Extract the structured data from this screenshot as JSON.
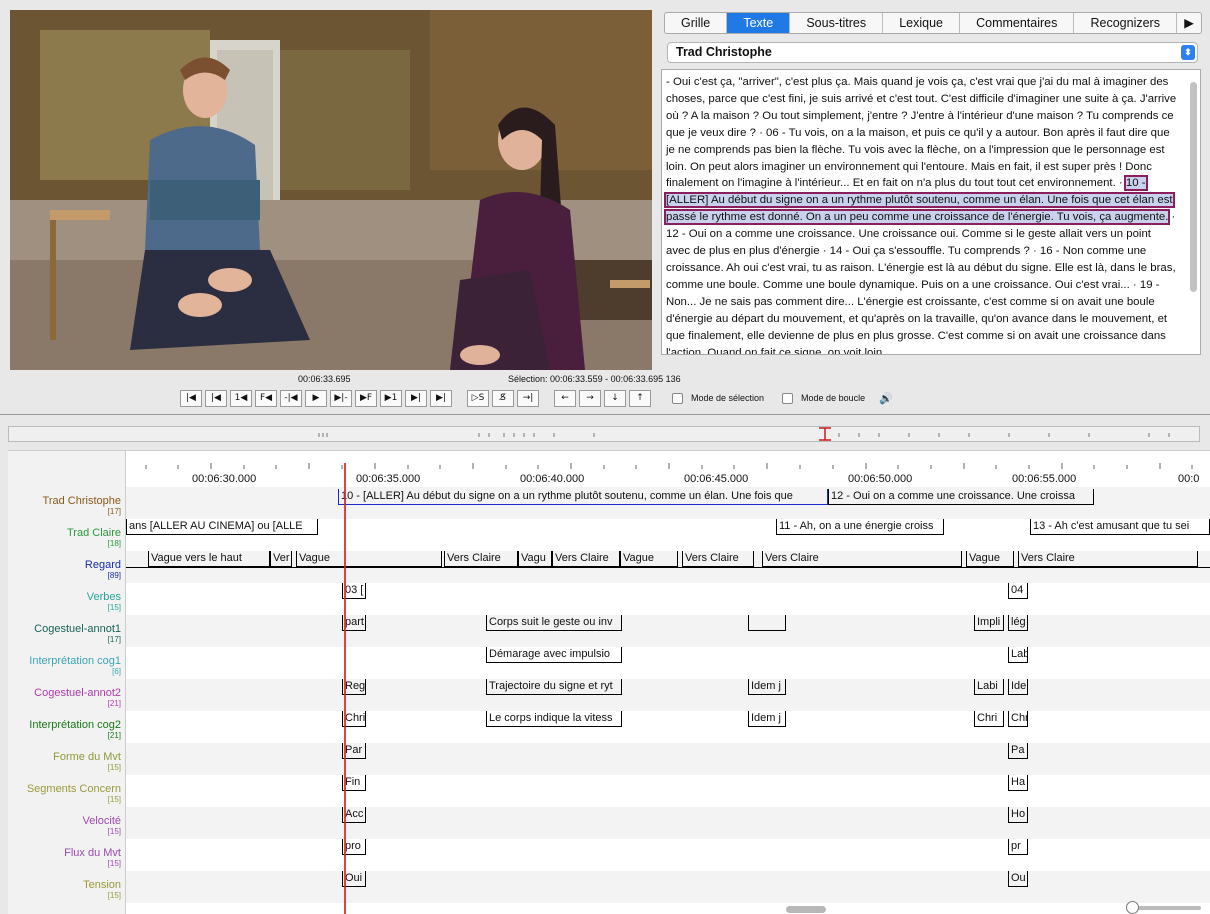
{
  "tabs": [
    "Grille",
    "Texte",
    "Sous-titres",
    "Lexique",
    "Commentaires",
    "Recognizers"
  ],
  "active_tab": "Texte",
  "more_tabs_glyph": "▶",
  "selected_tier": "Trad Christophe",
  "text": {
    "before": "- Oui c'est ça, \"arriver\", c'est plus ça. Mais quand je vois ça, c'est vrai que j'ai du mal à imaginer des choses, parce que c'est fini, je suis arrivé et c'est tout. C'est difficile d'imaginer une suite à ça. J'arrive où ? A la maison ? Ou tout simplement, j'entre ? J'entre à l'intérieur d'une maison ? Tu comprends ce que je veux dire ? · 06 - Tu vois, on a la maison, et puis ce qu'il y a autour. Bon après il faut dire que je ne comprends pas bien la flèche. Tu vois avec la flèche, on a l'impression que le personnage est loin. On peut alors imaginer un environnement qui l'entoure. Mais en fait, il est super près ! Donc finalement on l'imagine à l'intérieur... Et en fait on n'a plus du tout tout cet environnement. · ",
    "highlight": "10 - [ALLER] Au début du signe on a un rythme plutôt soutenu, comme un élan. Une fois que cet élan est passé le rythme est donné. On a un peu comme une croissance de l'énergie. Tu vois, ça augmente.",
    "after": " · 12 - Oui on a comme une croissance. Une croissance oui. Comme si le geste allait vers un point avec de plus en plus d'énergie · 14 - Oui ça s'essouffle. Tu comprends ? · 16 - Non comme une croissance. Ah oui c'est vrai, tu as raison. L'énergie est là au début du signe. Elle est là, dans le bras, comme une boule. Comme une boule dynamique. Puis on a une croissance. Oui c'est vrai... · 19 - Non... Je ne sais pas comment dire... L'énergie est croissante, c'est comme si on avait une boule d'énergie au départ du mouvement, et qu'après on la travaille, qu'on avance dans le mouvement, et que finalement, elle devienne de plus en plus grosse. C'est comme si on avait une croissance dans l'action. Quand on fait ce signe, on voit loin,"
  },
  "media": {
    "current_time": "00:06:33.695",
    "selection": "Sélection: 00:06:33.559 - 00:06:33.695  136",
    "buttons": [
      "|◀",
      "|◀",
      "1◀",
      "F◀",
      "-|◀",
      "▶",
      "▶|-",
      "▶F",
      "▶1",
      "▶|",
      "▶|"
    ],
    "sel_buttons": [
      "▷S",
      "S̸",
      "→|"
    ],
    "nav_buttons": [
      "←",
      "→",
      "↓",
      "↑"
    ],
    "selection_mode": "Mode de sélection",
    "loop_mode": "Mode de boucle"
  },
  "ruler": [
    "00:06:30.000",
    "00:06:35.000",
    "00:06:40.000",
    "00:06:45.000",
    "00:06:50.000",
    "00:06:55.000",
    "00:0"
  ],
  "tiers": [
    {
      "name": "Trad Christophe",
      "count": "[17]",
      "color": "#8a5a1a"
    },
    {
      "name": "Trad Claire",
      "count": "[18]",
      "color": "#2a9a3a"
    },
    {
      "name": "Regard",
      "count": "[89]",
      "color": "#1a2cb0"
    },
    {
      "name": "Verbes",
      "count": "[15]",
      "color": "#2aa59a"
    },
    {
      "name": "Cogestuel-annot1",
      "count": "[17]",
      "color": "#17645a"
    },
    {
      "name": "Interprétation cog1",
      "count": "[6]",
      "color": "#3aa5b5"
    },
    {
      "name": "Cogestuel-annot2",
      "count": "[21]",
      "color": "#b03ab0"
    },
    {
      "name": "Interprétation cog2",
      "count": "[21]",
      "color": "#1a7a1a"
    },
    {
      "name": "Forme du Mvt",
      "count": "[15]",
      "color": "#8f9a3a"
    },
    {
      "name": "Segments Concern",
      "count": "[15]",
      "color": "#9a9a3a"
    },
    {
      "name": "Velocité",
      "count": "[15]",
      "color": "#a04ab0"
    },
    {
      "name": "Flux du Mvt",
      "count": "[15]",
      "color": "#9a4ab0"
    },
    {
      "name": "Tension",
      "count": "[15]",
      "color": "#9a9a3a"
    }
  ],
  "annotations": {
    "trad_christophe": [
      "10 - [ALLER] Au début du signe on a un rythme plutôt soutenu, comme un élan. Une fois que",
      "12 - Oui on a comme une croissance. Une croissa"
    ],
    "trad_claire": [
      "ans [ALLER AU CINEMA] ou [ALLE",
      "11 - Ah, on a une énergie croiss",
      "13 - Ah c'est amusant que tu sei"
    ],
    "regard": [
      "Vague vers le haut",
      "Ver",
      "Vague",
      "Vers Claire",
      "Vagu",
      "Vers Claire",
      "Vague",
      "Vers Claire",
      "Vers Claire",
      "Vague",
      "Vers Claire"
    ],
    "verbes": [
      "03 [",
      "04"
    ],
    "cog1": [
      "part",
      "Corps suit le geste ou inv",
      "Impli",
      "lég"
    ],
    "interp1": [
      "Démarage avec impulsio",
      "Lab"
    ],
    "cog2": [
      "Reg",
      "Trajectoire du signe et ryt",
      "Idem j",
      "Labi",
      "Ide"
    ],
    "interp2": [
      "Chri",
      "Le corps indique la vitess",
      "Idem j",
      "Chri",
      "Chr"
    ],
    "forme": [
      "Par",
      "Pa"
    ],
    "segments": [
      "Fin",
      "Ha"
    ],
    "velocite": [
      "Acc",
      "Ho"
    ],
    "flux": [
      "pro",
      "pr"
    ],
    "tension": [
      "Oui",
      "Ou"
    ]
  }
}
